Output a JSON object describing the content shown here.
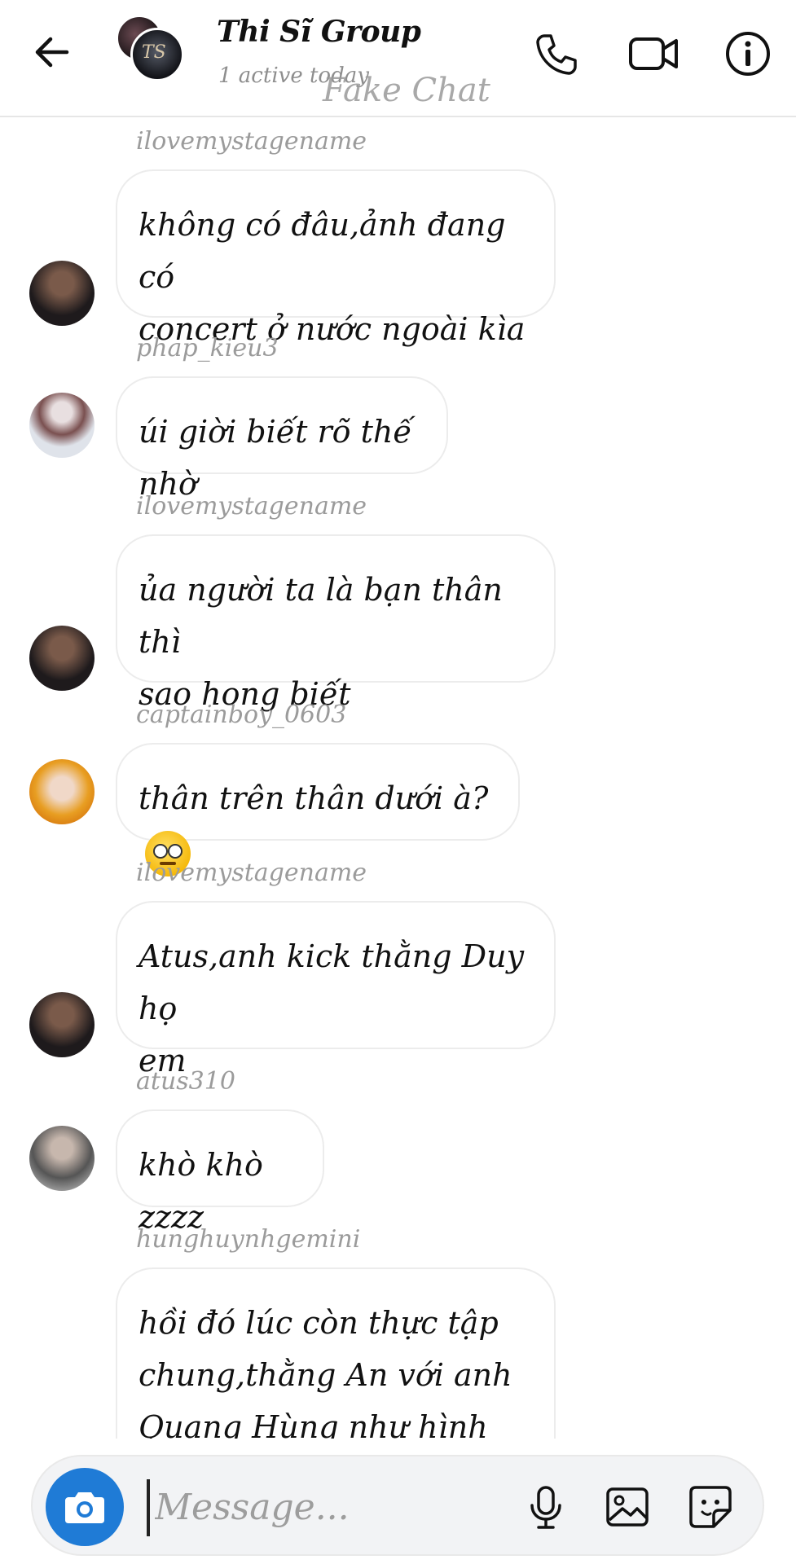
{
  "header": {
    "title": "Thi Sĩ Group",
    "subtitle": "1 active today",
    "watermark": "Fake Chat",
    "group_logo_text": "TS",
    "icons": [
      "arrow-left-icon",
      "phone-icon",
      "video-camera-icon",
      "info-icon"
    ]
  },
  "messages": [
    {
      "sender": "ilovemystagename",
      "lines": [
        "không có đâu,ảnh đang có",
        "concert ở nước ngoài kìa"
      ],
      "avatar": "avatar-1"
    },
    {
      "sender": "phap_kieu3",
      "lines": [
        "úi giời biết rõ thế nhờ"
      ],
      "avatar": "avatar-2"
    },
    {
      "sender": "ilovemystagename",
      "lines": [
        "ủa người ta là bạn thân thì",
        "sao hong biết"
      ],
      "avatar": "avatar-1"
    },
    {
      "sender": "captainboy_0603",
      "lines": [
        "thân trên thân dưới à?"
      ],
      "emoji": "face-with-rolling-eyes",
      "avatar": "avatar-3"
    },
    {
      "sender": "ilovemystagename",
      "lines": [
        "Atus,anh kick thằng Duy họ",
        "em"
      ],
      "avatar": "avatar-1"
    },
    {
      "sender": "atus310",
      "lines": [
        "khò khò zzzz"
      ],
      "avatar": "avatar-4"
    },
    {
      "sender": "hunghuynhgemini",
      "lines": [
        "hồi đó lúc còn thực tập",
        "chung,thằng An với anh",
        "Quang Hùng như hình với"
      ],
      "avatar": "avatar-5"
    }
  ],
  "composer": {
    "placeholder": "Message...",
    "icons": [
      "camera-icon",
      "microphone-icon",
      "gallery-icon",
      "sticker-icon"
    ]
  },
  "colors": {
    "accent": "#1f7bd6",
    "bubble_border": "#ececec",
    "sender_text": "#9b9b9b"
  }
}
